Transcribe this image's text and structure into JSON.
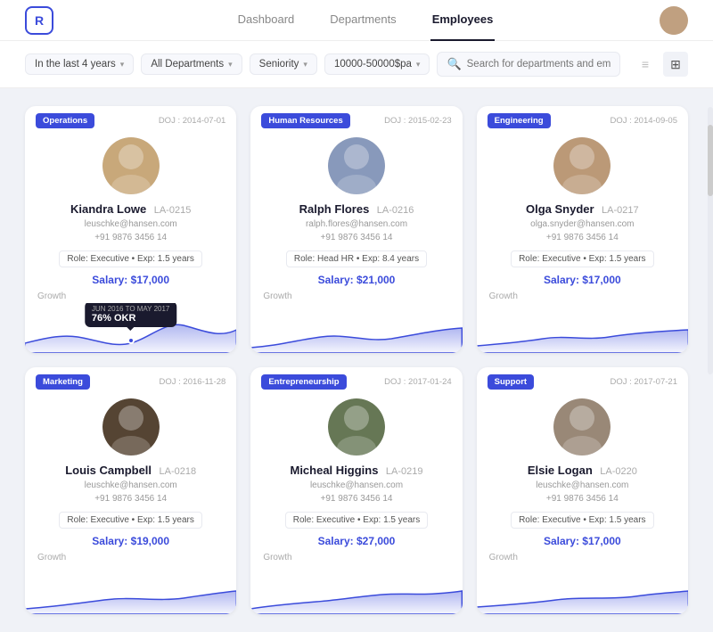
{
  "header": {
    "logo": "R",
    "nav": [
      {
        "label": "Dashboard",
        "active": false
      },
      {
        "label": "Departments",
        "active": false
      },
      {
        "label": "Employees",
        "active": true
      }
    ]
  },
  "filters": {
    "time": "In the last 4 years",
    "dept": "All Departments",
    "seniority": "Seniority",
    "salary": "10000-50000$pa",
    "search_placeholder": "Search for departments and employees"
  },
  "view_icons": {
    "list_icon": "≡",
    "grid_icon": "⊞"
  },
  "employees": [
    {
      "id": 0,
      "dept": "Operations",
      "dept_color": "#3b4bdb",
      "doj": "DOJ : 2014-07-01",
      "name": "Kiandra Lowe",
      "emp_id": "LA-0215",
      "email": "leuschke@hansen.com",
      "phone": "+91 9876 3456 14",
      "role": "Role: Executive",
      "exp": "Exp: 1.5 years",
      "salary": "Salary: $17,000",
      "growth_label": "Growth",
      "has_tooltip": true,
      "tooltip_date": "JUN 2016 TO MAY 2017",
      "tooltip_percent": "76% OKR",
      "chart_color": "#3b4bdb",
      "avatar_bg": "#c8a87a",
      "avatar_emoji": "🧑"
    },
    {
      "id": 1,
      "dept": "Human Resources",
      "dept_color": "#3b4bdb",
      "doj": "DOJ : 2015-02-23",
      "name": "Ralph Flores",
      "emp_id": "LA-0216",
      "email": "ralph.flores@hansen.com",
      "phone": "+91 9876 3456 14",
      "role": "Role: Head HR",
      "exp": "Exp: 8.4 years",
      "salary": "Salary: $21,000",
      "growth_label": "Growth",
      "has_tooltip": false,
      "avatar_bg": "#8899bb",
      "avatar_emoji": "🧔"
    },
    {
      "id": 2,
      "dept": "Engineering",
      "dept_color": "#3b4bdb",
      "doj": "DOJ : 2014-09-05",
      "name": "Olga Snyder",
      "emp_id": "LA-0217",
      "email": "olga.snyder@hansen.com",
      "phone": "+91 9876 3456 14",
      "role": "Role: Executive",
      "exp": "Exp: 1.5 years",
      "salary": "Salary: $17,000",
      "growth_label": "Growth",
      "has_tooltip": false,
      "avatar_bg": "#bb9977",
      "avatar_emoji": "👩"
    },
    {
      "id": 3,
      "dept": "Marketing",
      "dept_color": "#3b4bdb",
      "doj": "DOJ : 2016-11-28",
      "name": "Louis Campbell",
      "emp_id": "LA-0218",
      "email": "leuschke@hansen.com",
      "phone": "+91 9876 3456 14",
      "role": "Role: Executive",
      "exp": "Exp: 1.5 years",
      "salary": "Salary: $19,000",
      "growth_label": "Growth",
      "has_tooltip": false,
      "avatar_bg": "#554433",
      "avatar_emoji": "👨"
    },
    {
      "id": 4,
      "dept": "Entrepreneurship",
      "dept_color": "#3b4bdb",
      "doj": "DOJ : 2017-01-24",
      "name": "Micheal Higgins",
      "emp_id": "LA-0219",
      "email": "leuschke@hansen.com",
      "phone": "+91 9876 3456 14",
      "role": "Role: Executive",
      "exp": "Exp: 1.5 years",
      "salary": "Salary: $27,000",
      "growth_label": "Growth",
      "has_tooltip": false,
      "avatar_bg": "#667755",
      "avatar_emoji": "🧓"
    },
    {
      "id": 5,
      "dept": "Support",
      "dept_color": "#3b4bdb",
      "doj": "DOJ : 2017-07-21",
      "name": "Elsie Logan",
      "emp_id": "LA-0220",
      "email": "leuschke@hansen.com",
      "phone": "+91 9876 3456 14",
      "role": "Role: Executive",
      "exp": "Exp: 1.5 years",
      "salary": "Salary: $17,000",
      "growth_label": "Growth",
      "has_tooltip": false,
      "avatar_bg": "#998877",
      "avatar_emoji": "👩"
    }
  ]
}
